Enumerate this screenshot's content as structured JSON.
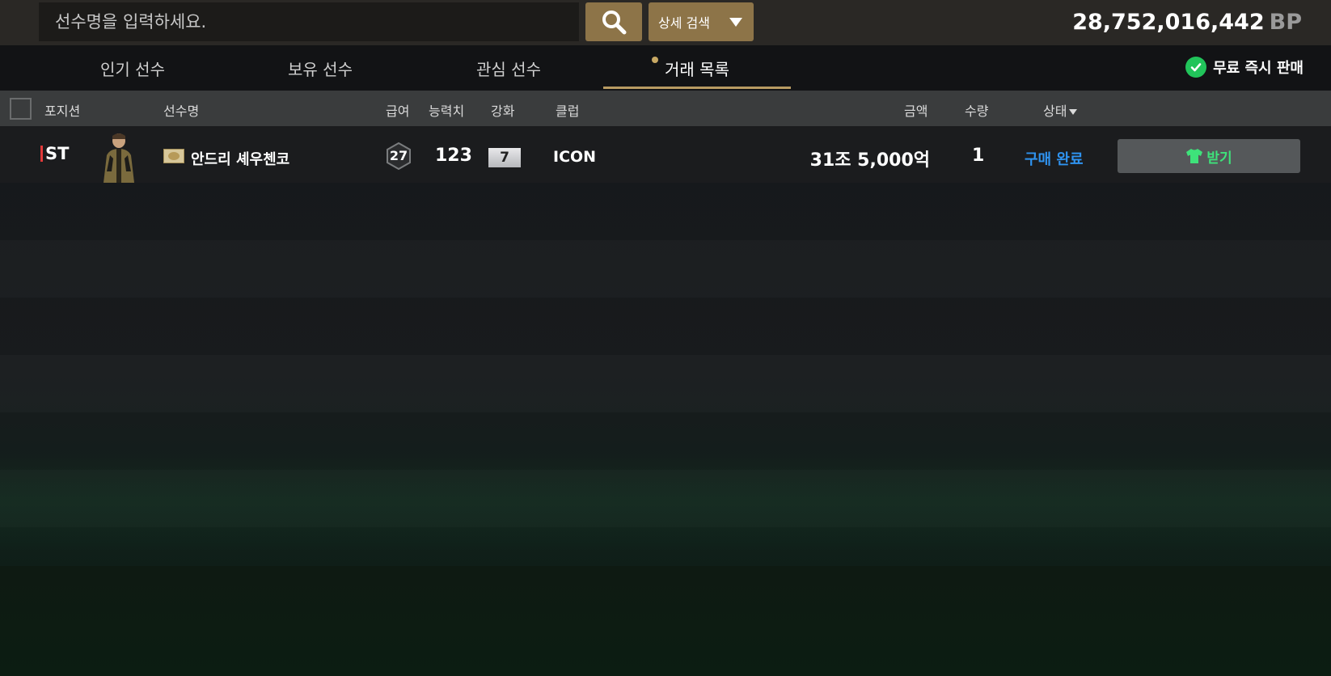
{
  "search": {
    "placeholder": "선수명을 입력하세요.",
    "detail_label": "상세 검색"
  },
  "balance": {
    "amount": "28,752,016,442",
    "unit": "BP"
  },
  "tabs": [
    {
      "label": "인기 선수",
      "active": false
    },
    {
      "label": "보유 선수",
      "active": false
    },
    {
      "label": "관심 선수",
      "active": false
    },
    {
      "label": "거래 목록",
      "active": true
    }
  ],
  "free_sell_label": "무료 즉시 판매",
  "table": {
    "headers": {
      "position": "포지션",
      "name": "선수명",
      "salary": "급여",
      "ovr": "능력치",
      "enhance": "강화",
      "club": "클럽",
      "price": "금액",
      "quantity": "수량",
      "status": "상태"
    },
    "rows": [
      {
        "position": "ST",
        "name": "안드리 셰우첸코",
        "salary": "27",
        "ovr": "123",
        "enhance": "7",
        "club": "ICON",
        "price": "31조 5,000억",
        "quantity": "1",
        "status": "구매 완료",
        "action_label": "받기"
      }
    ]
  },
  "colors": {
    "accent_gold": "#8d7448",
    "status_blue": "#2f93f0",
    "receive_green": "#3ee27a",
    "position_red": "#e23a3a"
  }
}
